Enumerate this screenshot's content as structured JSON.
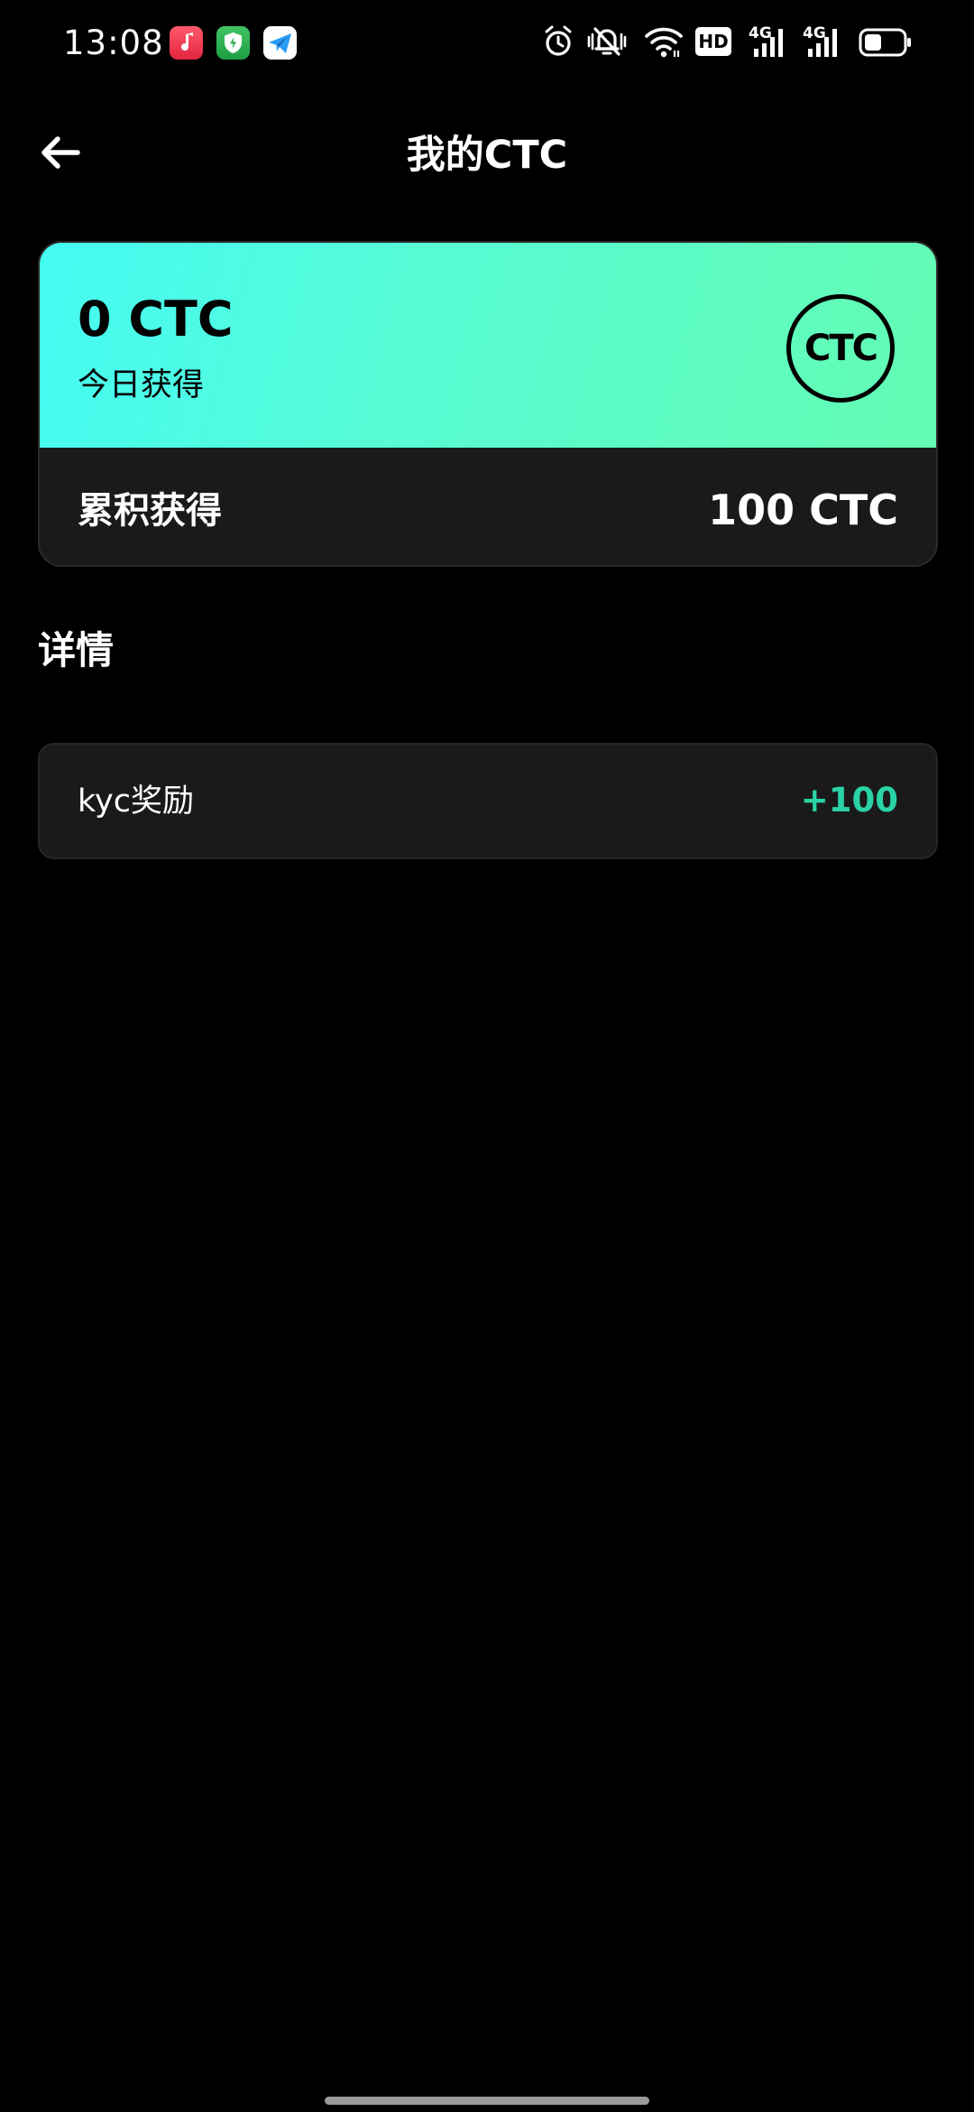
{
  "status_bar": {
    "time": "13:08",
    "hd_label": "HD",
    "network_1": "4G",
    "network_2": "4G"
  },
  "header": {
    "title": "我的CTC"
  },
  "summary": {
    "today_amount": "0 CTC",
    "today_label": "今日获得",
    "logo_text": "CTC",
    "total_label": "累积获得",
    "total_amount": "100 CTC"
  },
  "details": {
    "title": "详情",
    "items": [
      {
        "label": "kyc奖励",
        "value": "+100"
      }
    ]
  },
  "colors": {
    "background": "#000000",
    "card_gradient_start": "#45fbf3",
    "card_gradient_end": "#63fcb2",
    "accent_positive": "#2ad3a6",
    "card_dark": "#1a1a1a"
  },
  "icons": {
    "back": "arrow-left-icon",
    "alarm": "alarm-icon",
    "mute": "bell-off-icon",
    "wifi": "wifi-icon",
    "battery": "battery-icon"
  }
}
